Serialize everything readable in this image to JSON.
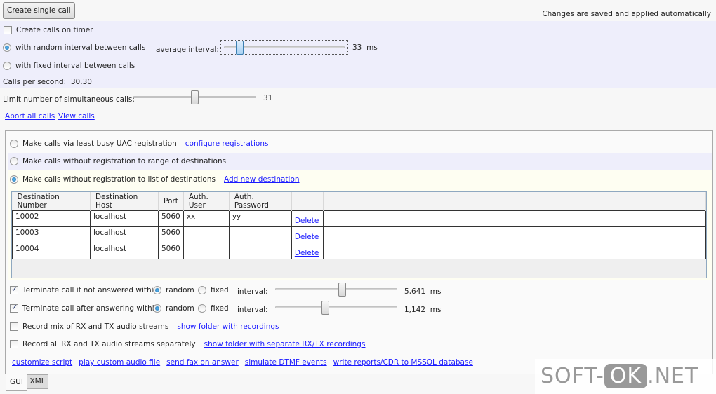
{
  "top": {
    "create_single_call": "Create single call",
    "autosave_note": "Changes are saved and applied automatically"
  },
  "timer": {
    "create_on_timer": "Create calls on timer",
    "create_on_timer_checked": false,
    "random_label": "with random interval between calls",
    "random_selected": true,
    "fixed_label": "with fixed interval between calls",
    "fixed_selected": false,
    "avg_interval_label": "average interval:",
    "avg_interval_value": "33",
    "avg_interval_unit": "ms",
    "avg_interval_fraction": 0.14,
    "cps_label": "Calls per second:",
    "cps_value": "30.30"
  },
  "limit": {
    "label": "Limit number of simultaneous calls:",
    "value": "31",
    "fraction": 0.5
  },
  "links": {
    "abort": "Abort all calls",
    "view": "View calls"
  },
  "mode": {
    "uac_label": "Make calls via least busy UAC registration",
    "uac_link": "configure registrations",
    "range_label": "Make calls without registration to range of destinations",
    "list_label": "Make calls without registration to list of destinations",
    "list_link": "Add new destination",
    "selected": "list"
  },
  "table": {
    "headers": [
      "Destination Number",
      "Destination Host",
      "Port",
      "Auth. User",
      "Auth. Password"
    ],
    "delete_label": "Delete",
    "rows": [
      [
        "10002",
        "localhost",
        "5060",
        "xx",
        "yy"
      ],
      [
        "10003",
        "localhost",
        "5060",
        "",
        ""
      ],
      [
        "10004",
        "localhost",
        "5060",
        "",
        ""
      ]
    ]
  },
  "terminate": [
    {
      "label": "Terminate call if not answered within",
      "checked": true,
      "random": "random",
      "fixed": "fixed",
      "mode": "random",
      "interval_label": "interval:",
      "value": "5,641",
      "unit": "ms",
      "fraction": 0.55
    },
    {
      "label": "Terminate call after answering within",
      "checked": true,
      "random": "random",
      "fixed": "fixed",
      "mode": "random",
      "interval_label": "interval:",
      "value": "1,142",
      "unit": "ms",
      "fraction": 0.41
    }
  ],
  "record": [
    {
      "label": "Record mix of RX and TX audio streams",
      "checked": false,
      "link": "show folder with recordings"
    },
    {
      "label": "Record all RX and TX audio streams separately",
      "checked": false,
      "link": "show folder with separate RX/TX recordings"
    }
  ],
  "bottom_links": [
    "customize script",
    "play custom audio file",
    "send fax on answer",
    "simulate DTMF events",
    "write reports/CDR to MSSQL database"
  ],
  "tabs": [
    {
      "label": "GUI",
      "selected": true
    },
    {
      "label": "XML",
      "selected": false
    }
  ],
  "watermark": "SOFT-OK.NET"
}
